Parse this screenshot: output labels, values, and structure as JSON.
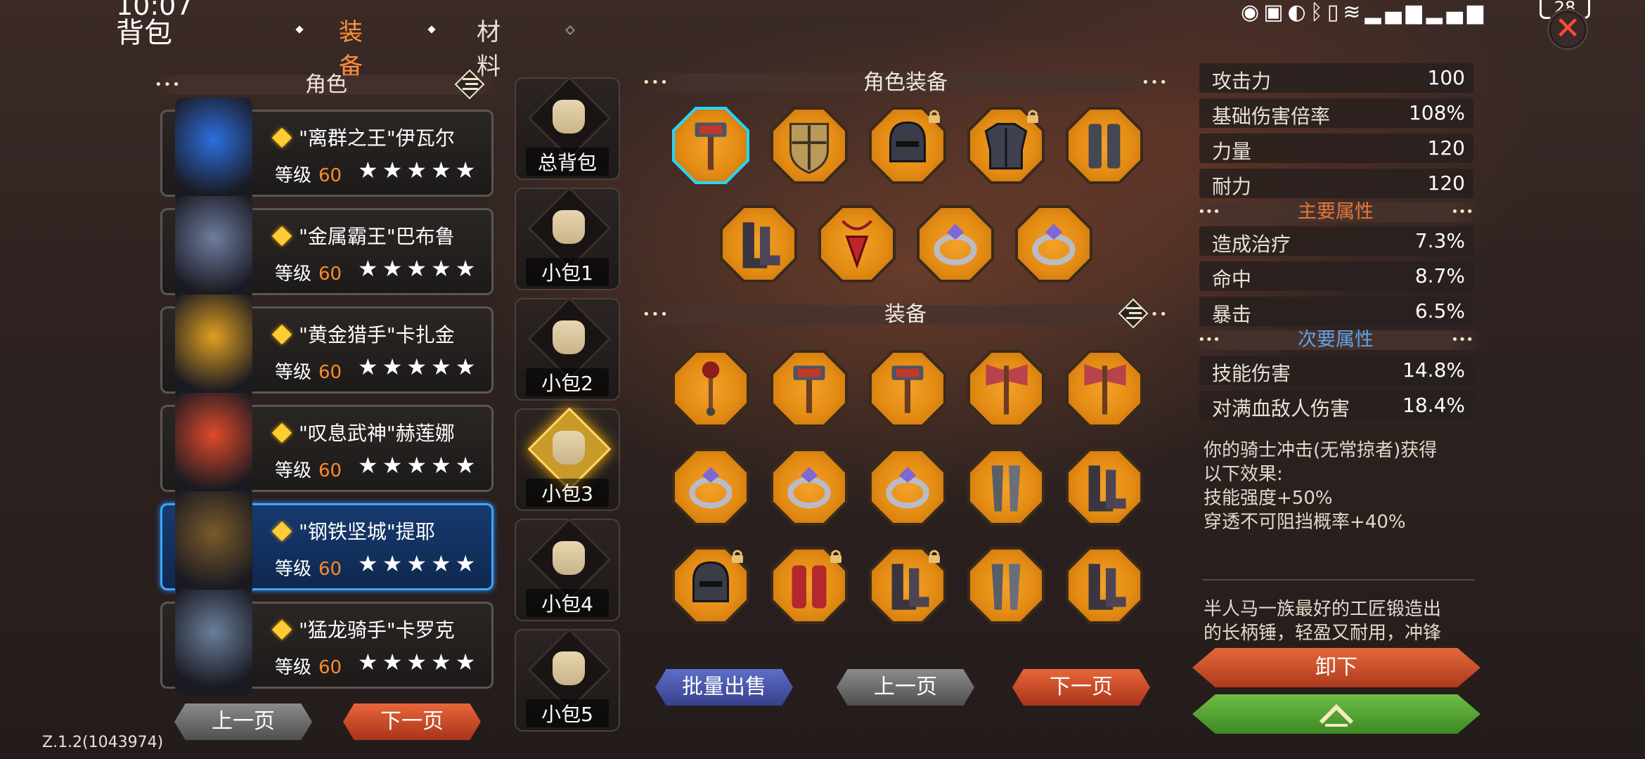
{
  "status": {
    "time": "10:07",
    "battery": "28"
  },
  "page": {
    "title": "背包"
  },
  "tabs": [
    {
      "label": "装备",
      "active": true
    },
    {
      "label": "材料",
      "active": false
    }
  ],
  "roles_panel": {
    "title": "角色",
    "prev": "上一页",
    "next": "下一页"
  },
  "characters": [
    {
      "name": "\"离群之王\"伊瓦尔",
      "level_label": "等级",
      "level": "60",
      "stars": "★★★★★",
      "selected": false
    },
    {
      "name": "\"金属霸王\"巴布鲁",
      "level_label": "等级",
      "level": "60",
      "stars": "★★★★★",
      "selected": false
    },
    {
      "name": "\"黄金猎手\"卡扎金",
      "level_label": "等级",
      "level": "60",
      "stars": "★★★★★",
      "selected": false
    },
    {
      "name": "\"叹息武神\"赫莲娜",
      "level_label": "等级",
      "level": "60",
      "stars": "★★★★★",
      "selected": false
    },
    {
      "name": "\"钢铁坚城\"提耶",
      "level_label": "等级",
      "level": "60",
      "stars": "★★★★★",
      "selected": true
    },
    {
      "name": "\"猛龙骑手\"卡罗克",
      "level_label": "等级",
      "level": "60",
      "stars": "★★★★★",
      "selected": false
    }
  ],
  "bags": [
    {
      "label": "总背包",
      "active": false
    },
    {
      "label": "小包1",
      "active": false
    },
    {
      "label": "小包2",
      "active": false
    },
    {
      "label": "小包3",
      "active": true
    },
    {
      "label": "小包4",
      "active": false
    },
    {
      "label": "小包5",
      "active": false
    }
  ],
  "char_equipment": {
    "title": "角色装备",
    "slots": [
      {
        "icon": "hammer-icon",
        "locked": false,
        "selected": true
      },
      {
        "icon": "shield-icon",
        "locked": false,
        "selected": false
      },
      {
        "icon": "helmet-icon",
        "locked": true,
        "selected": false
      },
      {
        "icon": "chest-armor-icon",
        "locked": true,
        "selected": false
      },
      {
        "icon": "leg-armor-icon",
        "locked": false,
        "selected": false
      },
      {
        "icon": "boots-icon",
        "locked": false,
        "selected": false
      },
      {
        "icon": "amulet-icon",
        "locked": false,
        "selected": false
      },
      {
        "icon": "ring-icon",
        "locked": false,
        "selected": false
      },
      {
        "icon": "ring-icon",
        "locked": false,
        "selected": false
      }
    ]
  },
  "inventory": {
    "title": "装备",
    "items": [
      {
        "icon": "mace-icon",
        "locked": false
      },
      {
        "icon": "hammer-icon",
        "locked": false
      },
      {
        "icon": "hammer-icon",
        "locked": false
      },
      {
        "icon": "axe-icon",
        "locked": false
      },
      {
        "icon": "axe-icon",
        "locked": false
      },
      {
        "icon": "ring-icon",
        "locked": false
      },
      {
        "icon": "ring-icon",
        "locked": false
      },
      {
        "icon": "ring-icon",
        "locked": false
      },
      {
        "icon": "gauntlet-icon",
        "locked": false
      },
      {
        "icon": "boots-icon",
        "locked": false
      },
      {
        "icon": "helmet-icon",
        "locked": true
      },
      {
        "icon": "bracers-icon",
        "locked": true
      },
      {
        "icon": "boots-icon",
        "locked": true
      },
      {
        "icon": "gauntlet-icon",
        "locked": false
      },
      {
        "icon": "boots-icon",
        "locked": false
      }
    ],
    "batch_sell": "批量出售",
    "prev": "上一页",
    "next": "下一页"
  },
  "stats": {
    "base": [
      {
        "k": "攻击力",
        "v": "100"
      },
      {
        "k": "基础伤害倍率",
        "v": "108%"
      },
      {
        "k": "力量",
        "v": "120"
      },
      {
        "k": "耐力",
        "v": "120"
      }
    ],
    "main_title": "主要属性",
    "main": [
      {
        "k": "造成治疗",
        "v": "7.3%"
      },
      {
        "k": "命中",
        "v": "8.7%"
      },
      {
        "k": "暴击",
        "v": "6.5%"
      }
    ],
    "secondary_title": "次要属性",
    "secondary": [
      {
        "k": "技能伤害",
        "v": "14.8%"
      },
      {
        "k": "对满血敌人伤害",
        "v": "18.4%"
      }
    ],
    "effect": [
      "你的骑士冲击(无常掠者)获得",
      "以下效果:",
      "技能强度+50%",
      "穿透不可阻挡概率+40%"
    ],
    "lore": [
      "半人马一族最好的工匠锻造出",
      "的长柄锤，轻盈又耐用，冲锋"
    ],
    "unequip": "卸下"
  },
  "version": "Z.1.2(1043974)",
  "colors": {
    "accent_orange": "#ff8f3a",
    "selected_blue": "#3aa7ff",
    "slot_orange": "#e48c14",
    "main_attr": "#e6773a",
    "sec_attr": "#5fa4e6"
  }
}
